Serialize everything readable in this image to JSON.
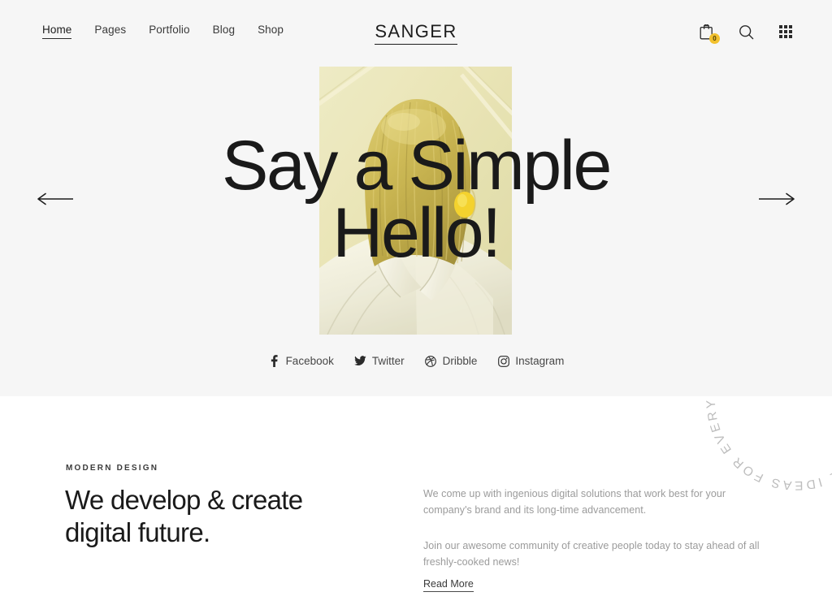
{
  "header": {
    "logo": "SANGER",
    "nav": [
      {
        "label": "Home",
        "active": true
      },
      {
        "label": "Pages",
        "active": false
      },
      {
        "label": "Portfolio",
        "active": false
      },
      {
        "label": "Blog",
        "active": false
      },
      {
        "label": "Shop",
        "active": false
      }
    ],
    "icons": {
      "cart": "shopping-bag-icon",
      "cart_count": "0",
      "search": "search-icon",
      "grid": "grid-menu-icon"
    }
  },
  "hero": {
    "title_line1": "Say a Simple",
    "title_line2": "Hello!",
    "prev_arrow": "arrow-left-icon",
    "next_arrow": "arrow-right-icon",
    "image_alt": "blonde person seen from behind wearing white collared jacket",
    "socials": [
      {
        "label": "Facebook",
        "icon": "facebook-icon"
      },
      {
        "label": "Twitter",
        "icon": "twitter-icon"
      },
      {
        "label": "Dribble",
        "icon": "dribbble-icon"
      },
      {
        "label": "Instagram",
        "icon": "instagram-icon"
      }
    ]
  },
  "about": {
    "eyebrow": "MODERN DESIGN",
    "heading_line1": "We develop & create",
    "heading_line2": "digital future.",
    "paragraph1": "We come up with ingenious digital solutions that work best for your company's brand and its long-time advancement.",
    "paragraph2": "Join our awesome community of creative people today to stay ahead of all freshly-cooked news!",
    "read_more": "Read More"
  },
  "badge": {
    "text": "UNIQUE IDEAS FOR EVERY PROJECT. "
  },
  "colors": {
    "hero_background": "#f6f6f6",
    "page_background": "#ffffff",
    "text_dark": "#1a1a1a",
    "text_muted": "#9b9b9b",
    "accent_yellow": "#f2c12e",
    "badge_text": "#bdbdbd"
  }
}
